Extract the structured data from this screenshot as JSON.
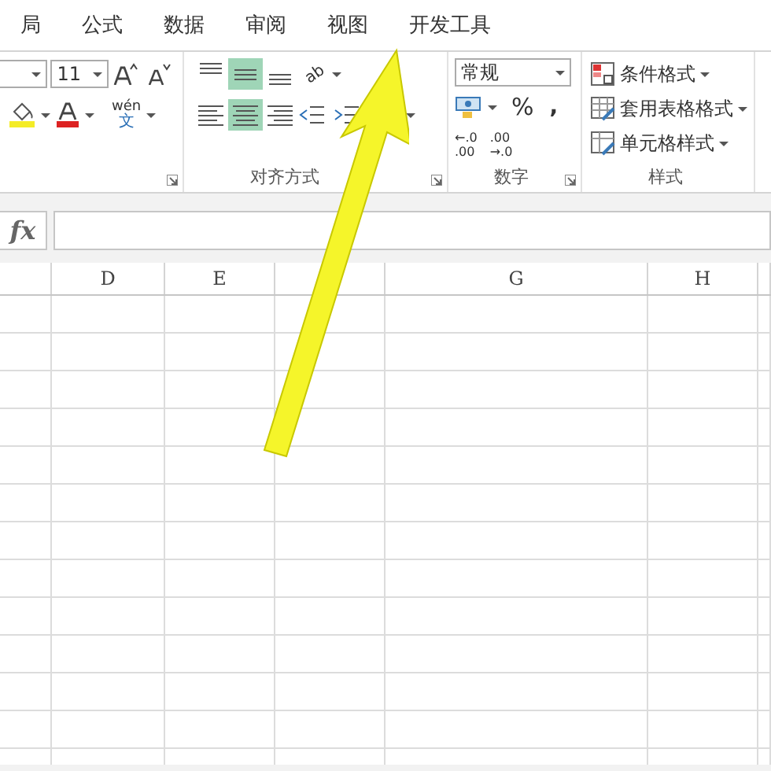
{
  "tabs": [
    {
      "label": "局"
    },
    {
      "label": "公式"
    },
    {
      "label": "数据"
    },
    {
      "label": "审阅"
    },
    {
      "label": "视图"
    },
    {
      "label": "开发工具"
    }
  ],
  "ribbon": {
    "font_group": {
      "font_size": "11",
      "phonetic_pinyin": "wén",
      "phonetic_char": "文"
    },
    "alignment_group": {
      "label": "对齐方式",
      "orientation_glyph": "ab",
      "vertical_align": [
        {
          "kind": "top",
          "selected": false
        },
        {
          "kind": "middle",
          "selected": true
        },
        {
          "kind": "bottom",
          "selected": false
        }
      ],
      "horizontal_align": [
        {
          "kind": "left",
          "selected": false
        },
        {
          "kind": "center",
          "selected": true
        },
        {
          "kind": "right",
          "selected": false
        }
      ]
    },
    "number_group": {
      "label": "数字",
      "format": "常规",
      "percent": "%",
      "comma": ",",
      "increase_decimal": [
        "←.0",
        ".00"
      ],
      "decrease_decimal": [
        ".00",
        "→.0"
      ]
    },
    "styles_group": {
      "label": "样式",
      "items": [
        {
          "label": "条件格式"
        },
        {
          "label": "套用表格格式"
        },
        {
          "label": "单元格样式"
        }
      ]
    }
  },
  "formula_bar": {
    "function_label": "fx"
  },
  "sheet": {
    "columns": [
      "D",
      "E",
      "G",
      "H"
    ]
  }
}
